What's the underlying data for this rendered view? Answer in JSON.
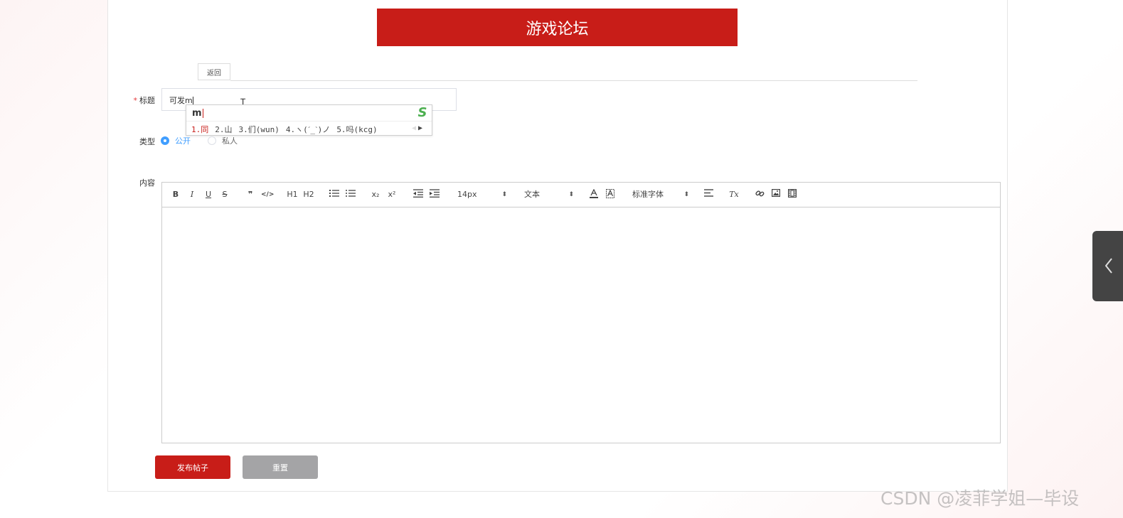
{
  "header": {
    "title": "游戏论坛"
  },
  "back_button": "返回",
  "form": {
    "title_label": "标题",
    "required_mark": "*",
    "title_value": "可发m",
    "type_label": "类型",
    "type_options": [
      {
        "label": "公开",
        "selected": true
      },
      {
        "label": "私人",
        "selected": false
      }
    ],
    "content_label": "内容"
  },
  "ime": {
    "composition": "m",
    "logo": "S",
    "candidates": [
      "1.同",
      "2.山",
      "3.们(wun)",
      "4.ヽ(ˊ_ˋ)ノ",
      "5.吗(kcg)"
    ]
  },
  "editor_toolbar": {
    "bold": "B",
    "italic": "I",
    "underline": "U",
    "strike": "S",
    "blockquote": "❞",
    "code": "</>",
    "h1": "H1",
    "h2": "H2",
    "subscript": "x₂",
    "superscript": "x²",
    "font_size": "14px",
    "header_select": "文本",
    "font_family": "标准字体",
    "clean": "Tx"
  },
  "buttons": {
    "submit": "发布帖子",
    "reset": "重置"
  },
  "watermark": "CSDN @凌菲学姐—毕设",
  "colors": {
    "brand_red": "#c81d18",
    "accent_blue": "#409eff",
    "reset_gray": "#a4a4a6"
  }
}
